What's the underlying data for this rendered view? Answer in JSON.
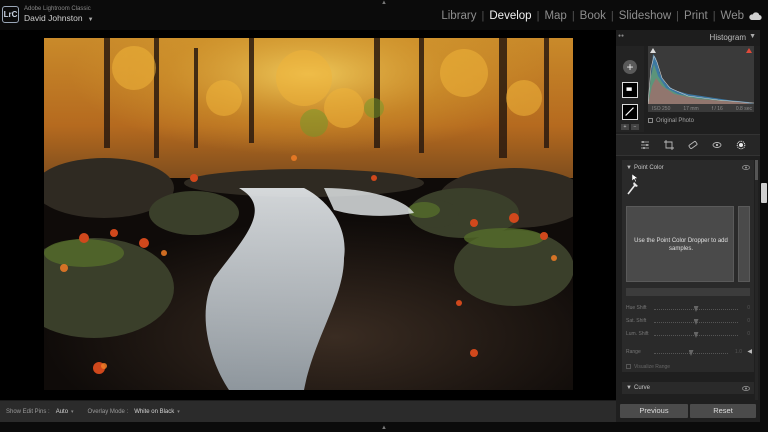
{
  "app": {
    "badge": "LrC",
    "name": "Adobe Lightroom Classic",
    "user": "David Johnston",
    "user_caret": "▼"
  },
  "modules": [
    {
      "label": "Library",
      "active": false
    },
    {
      "label": "Develop",
      "active": true
    },
    {
      "label": "Map",
      "active": false
    },
    {
      "label": "Book",
      "active": false
    },
    {
      "label": "Slideshow",
      "active": false
    },
    {
      "label": "Print",
      "active": false
    },
    {
      "label": "Web",
      "active": false
    }
  ],
  "module_separator": "|",
  "histogram": {
    "title": "Histogram",
    "caret": "▼",
    "exif": [
      "ISO 250",
      "17 mm",
      "f / 16",
      "0.8 sec"
    ],
    "original_photo": "Original Photo"
  },
  "point_color": {
    "title": "Point Color",
    "caret": "▼",
    "message": "Use the Point Color Dropper to add samples.",
    "sliders": [
      {
        "label": "Hue Shift",
        "value": "0",
        "level": 0.5
      },
      {
        "label": "Sat. Shift",
        "value": "0",
        "level": 0.5
      },
      {
        "label": "Lum. Shift",
        "value": "0",
        "level": 0.5
      }
    ],
    "range": {
      "label": "Range",
      "value": "1.0",
      "level": 0.5,
      "end": "◀"
    },
    "visualize": "Visualize Range"
  },
  "curve": {
    "title": "Curve",
    "caret": "▼"
  },
  "buttons": {
    "previous": "Previous",
    "reset": "Reset"
  },
  "toolbar": {
    "edit_pins_label": "Show Edit Pins :",
    "edit_pins_value": "Auto",
    "overlay_label": "Overlay Mode :",
    "overlay_value": "White on Black",
    "caret": "▾"
  },
  "colors": {
    "accent": "#f2f2f2",
    "panel": "#1f1f1f",
    "section": "#2a2a2a"
  },
  "icons": [
    "cloud-icon",
    "eye-icon",
    "dropper-icon",
    "plus-icon",
    "chevron-down-icon",
    "triangle-collapse-icon"
  ]
}
